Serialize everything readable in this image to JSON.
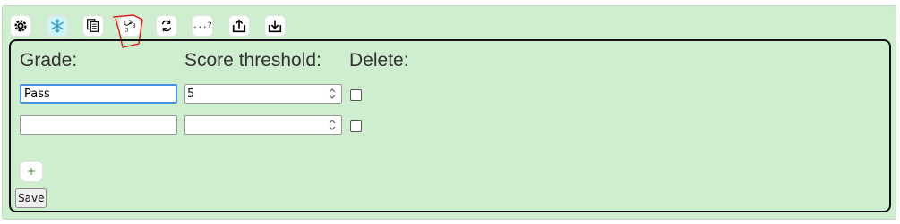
{
  "toolbar": {
    "more_label": "...?"
  },
  "table": {
    "headers": {
      "grade": "Grade:",
      "score_threshold": "Score threshold:",
      "delete": "Delete:"
    },
    "rows": [
      {
        "grade": "Pass",
        "threshold": "5",
        "delete": false
      },
      {
        "grade": "",
        "threshold": "",
        "delete": false
      }
    ]
  },
  "add_label": "+",
  "save_label": "Save",
  "colors": {
    "background": "#cfedcf",
    "focus_ring": "#4a90e2",
    "annotation": "#e01b1b"
  }
}
